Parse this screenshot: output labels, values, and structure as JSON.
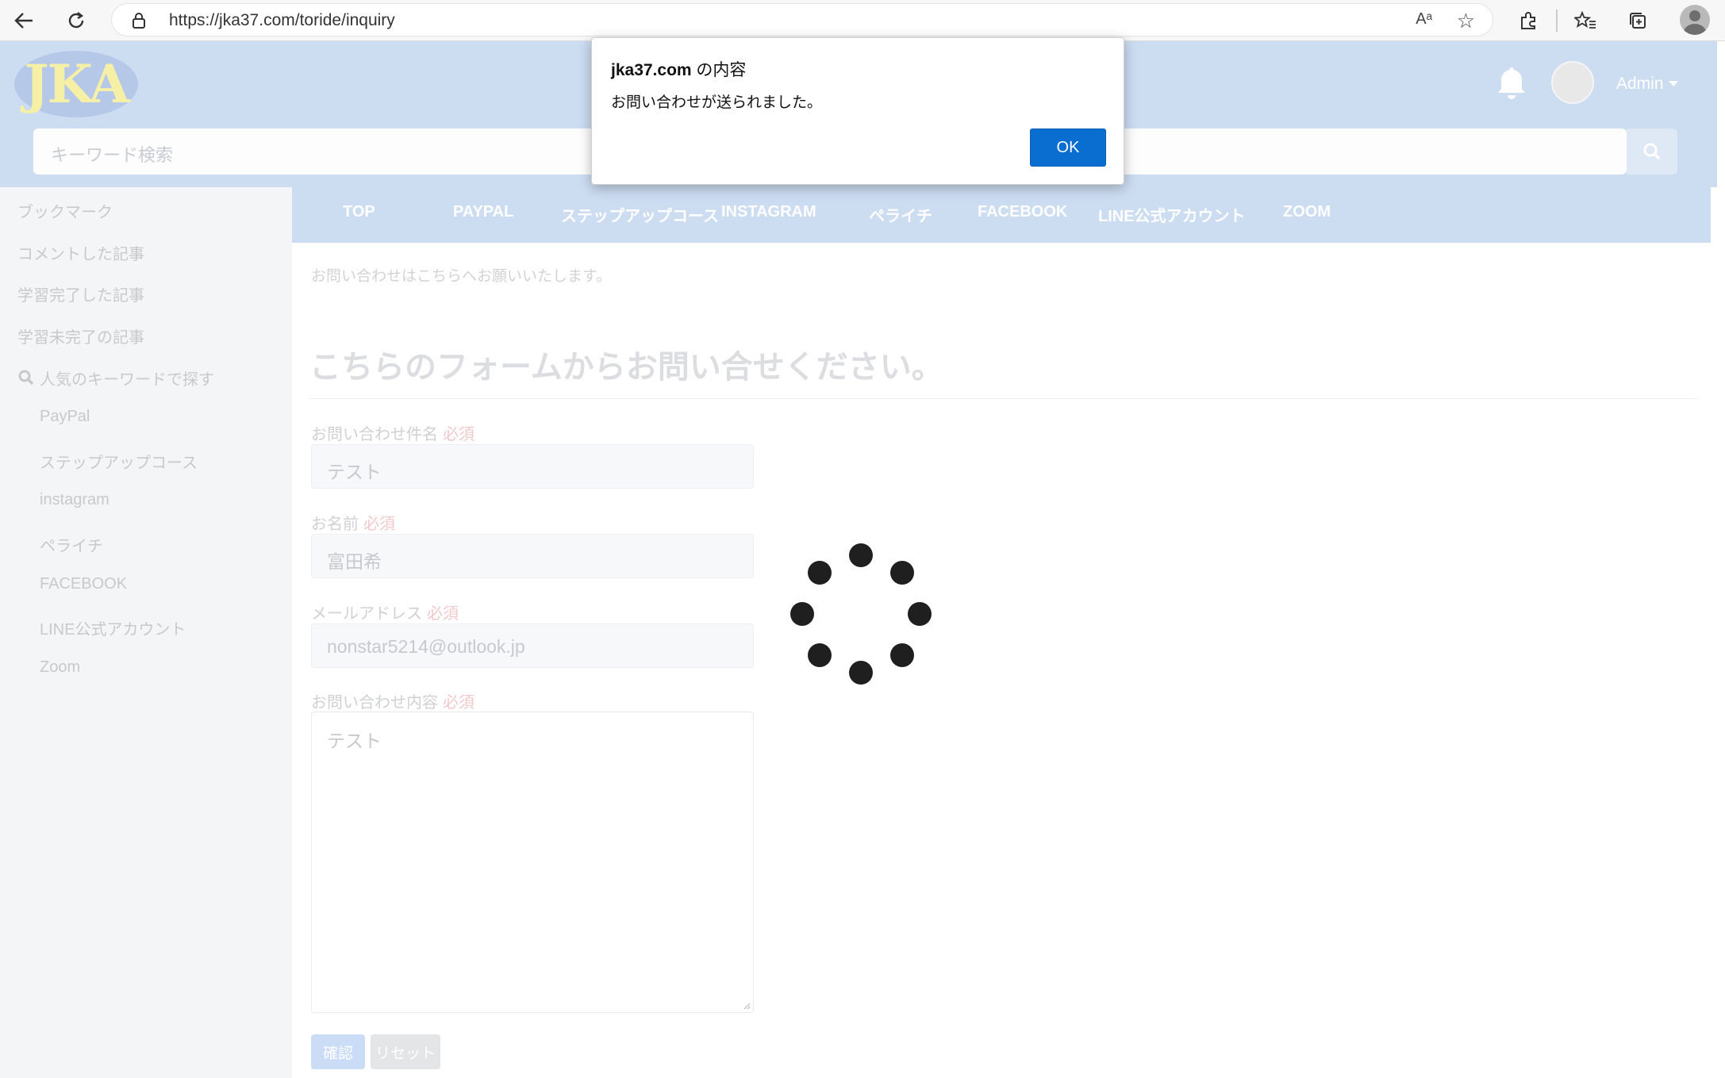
{
  "browser": {
    "url": "https://jka37.com/toride/inquiry",
    "read_aloud_label": "Aᵃ"
  },
  "header": {
    "logo_text": "JKA",
    "user_menu_label": "Admin",
    "search_placeholder": "キーワード検索"
  },
  "sidebar": {
    "items": [
      {
        "label": "ブックマーク"
      },
      {
        "label": "コメントした記事"
      },
      {
        "label": "学習完了した記事"
      },
      {
        "label": "学習未完了の記事"
      }
    ],
    "keyword_heading": "人気のキーワードで探す",
    "keywords": [
      {
        "label": "PayPal"
      },
      {
        "label": "ステップアップコース"
      },
      {
        "label": "instagram"
      },
      {
        "label": "ペライチ"
      },
      {
        "label": "FACEBOOK"
      },
      {
        "label": "LINE公式アカウント"
      },
      {
        "label": "Zoom"
      }
    ]
  },
  "nav": {
    "items": [
      {
        "label": "TOP"
      },
      {
        "label": "PAYPAL"
      },
      {
        "label": "ステップアップコース"
      },
      {
        "label": "INSTAGRAM"
      },
      {
        "label": "ペライチ"
      },
      {
        "label": "FACEBOOK"
      },
      {
        "label": "LINE公式アカウント"
      },
      {
        "label": "ZOOM"
      }
    ]
  },
  "main": {
    "intro": "お問い合わせはこちらへお願いいたします。",
    "title": "こちらのフォームからお問い合せください。",
    "required_label": "必須",
    "form": {
      "subject": {
        "label": "お問い合わせ件名",
        "value": "テスト"
      },
      "name": {
        "label": "お名前",
        "value": "富田希"
      },
      "email": {
        "label": "メールアドレス",
        "value": "nonstar5214@outlook.jp"
      },
      "message": {
        "label": "お問い合わせ内容",
        "value": "テスト"
      }
    },
    "confirm_label": "確認",
    "reset_label": "リセット"
  },
  "dialog": {
    "origin": "jka37.com",
    "title_suffix": " の内容",
    "message": "お問い合わせが送られました。",
    "ok_label": "OK",
    "ok_color": "#0a6ed1"
  },
  "colors": {
    "header_bg": "#ccdcf1",
    "sidebar_bg": "#f4f5f6"
  },
  "icons": {
    "back": "back-arrow-icon",
    "reload": "reload-icon",
    "lock": "lock-icon",
    "favorite": "add-favorite-icon",
    "extensions": "extensions-icon",
    "favorites": "favorites-icon",
    "collections": "collections-icon",
    "bell": "bell-icon",
    "search": "search-icon",
    "spinner": "loading-spinner-icon"
  }
}
